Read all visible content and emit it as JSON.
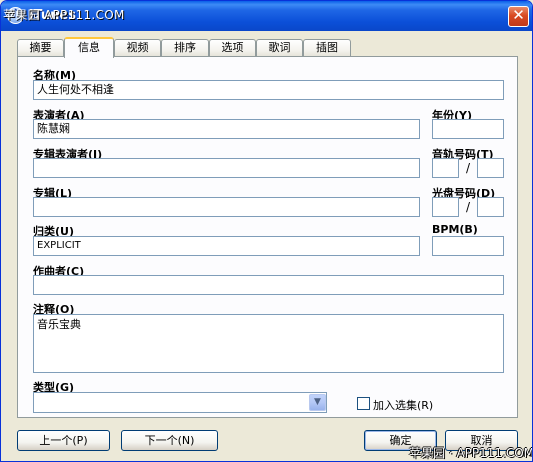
{
  "window": {
    "title": "iTunes",
    "watermark_top": "苹果园 APP111.COM",
    "watermark_bottom": "苹果园 · APP111.COM",
    "close_glyph": "✕"
  },
  "tabs": [
    {
      "label": "摘要",
      "active": false
    },
    {
      "label": "信息",
      "active": true
    },
    {
      "label": "视频",
      "active": false
    },
    {
      "label": "排序",
      "active": false
    },
    {
      "label": "选项",
      "active": false
    },
    {
      "label": "歌词",
      "active": false
    },
    {
      "label": "插图",
      "active": false
    }
  ],
  "fields": {
    "name": {
      "label": "名称(M)",
      "value": "人生何处不相逢"
    },
    "artist": {
      "label": "表演者(A)",
      "value": "陈慧娴"
    },
    "year": {
      "label": "年份(Y)",
      "value": ""
    },
    "album_artist": {
      "label": "专辑表演者(I)",
      "value": ""
    },
    "track_number": {
      "label": "音轨号码(T)",
      "value": "",
      "total": "",
      "separator": "/"
    },
    "album": {
      "label": "专辑(L)",
      "value": ""
    },
    "disc_number": {
      "label": "光盘号码(D)",
      "value": "",
      "total": "",
      "separator": "/"
    },
    "grouping": {
      "label": "归类(U)",
      "value": "EXPLICIT"
    },
    "bpm": {
      "label": "BPM(B)",
      "value": ""
    },
    "composer": {
      "label": "作曲者(C)",
      "value": ""
    },
    "comments": {
      "label": "注释(O)",
      "value": "音乐宝典"
    },
    "genre": {
      "label": "类型(G)",
      "value": ""
    },
    "compilation": {
      "label": "加入选集(R)",
      "checked": false
    }
  },
  "buttons": {
    "prev": "上一个(P)",
    "next": "下一个(N)",
    "ok": "确定",
    "cancel": "取消"
  },
  "icons": {
    "combo_arrow": "▼"
  }
}
